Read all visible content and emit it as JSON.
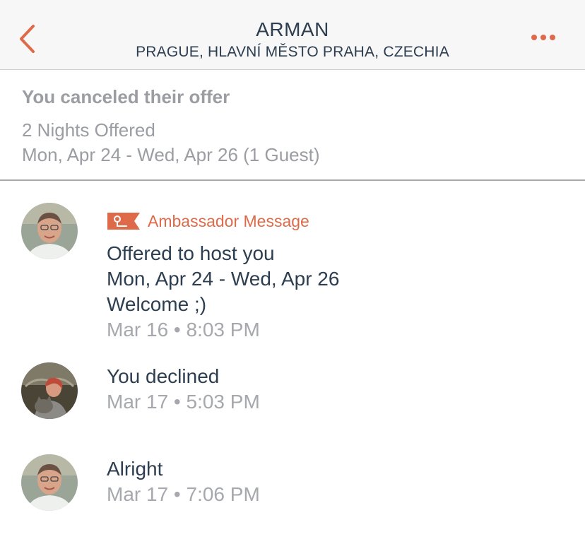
{
  "header": {
    "title": "ARMAN",
    "subtitle": "PRAGUE, HLAVNÍ MĚSTO PRAHA, CZECHIA",
    "back_icon": "chevron-left-icon",
    "more_icon": "more-horizontal-icon"
  },
  "offer": {
    "status": "You canceled their offer",
    "nights": "2 Nights Offered",
    "dates": "Mon, Apr 24 - Wed, Apr 26 (1 Guest)"
  },
  "messages": [
    {
      "sender": "host",
      "badge": "Ambassador Message",
      "lines": [
        "Offered to host you",
        "Mon, Apr 24 - Wed, Apr 26",
        "Welcome ;)"
      ],
      "time": "Mar 16 • 8:03 PM"
    },
    {
      "sender": "you",
      "lines": [
        "You declined"
      ],
      "time": "Mar 17 • 5:03 PM"
    },
    {
      "sender": "host",
      "lines": [
        "Alright"
      ],
      "time": "Mar 17 • 7:06 PM"
    }
  ],
  "colors": {
    "accent": "#df6a4a",
    "text_primary": "#2d3e50",
    "text_muted": "#9b9da3",
    "header_bg": "#f7f7f7"
  }
}
